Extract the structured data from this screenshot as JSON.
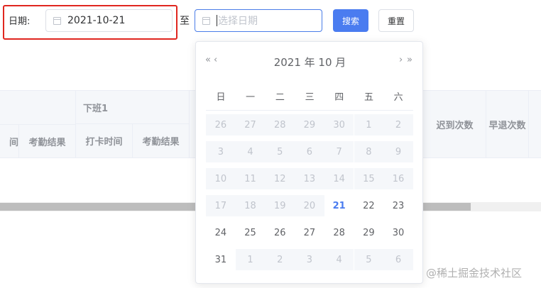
{
  "filter": {
    "label": "日期:",
    "start_value": "2021-10-21",
    "separator": "至",
    "end_placeholder": "选择日期",
    "search_label": "搜索",
    "reset_label": "重置"
  },
  "table": {
    "group_header": "下班1",
    "headers": [
      "间",
      "考勤结果",
      "打卡时间",
      "考勤结果",
      "迟到次数",
      "早退次数"
    ]
  },
  "calendar": {
    "title": "2021 年  10 月",
    "prev_year": "«",
    "prev_month": "‹",
    "next_month": "›",
    "next_year": "»",
    "weekdays": [
      "日",
      "一",
      "二",
      "三",
      "四",
      "五",
      "六"
    ],
    "weeks": [
      [
        "26",
        "27",
        "28",
        "29",
        "30",
        "1",
        "2"
      ],
      [
        "3",
        "4",
        "5",
        "6",
        "7",
        "8",
        "9"
      ],
      [
        "10",
        "11",
        "12",
        "13",
        "14",
        "15",
        "16"
      ],
      [
        "17",
        "18",
        "19",
        "20",
        "21",
        "22",
        "23"
      ],
      [
        "24",
        "25",
        "26",
        "27",
        "28",
        "29",
        "30"
      ],
      [
        "31",
        "1",
        "2",
        "3",
        "4",
        "5",
        "6"
      ]
    ],
    "today": "21",
    "accent": "#4a7cf0"
  },
  "watermark": "@稀土掘金技术社区"
}
